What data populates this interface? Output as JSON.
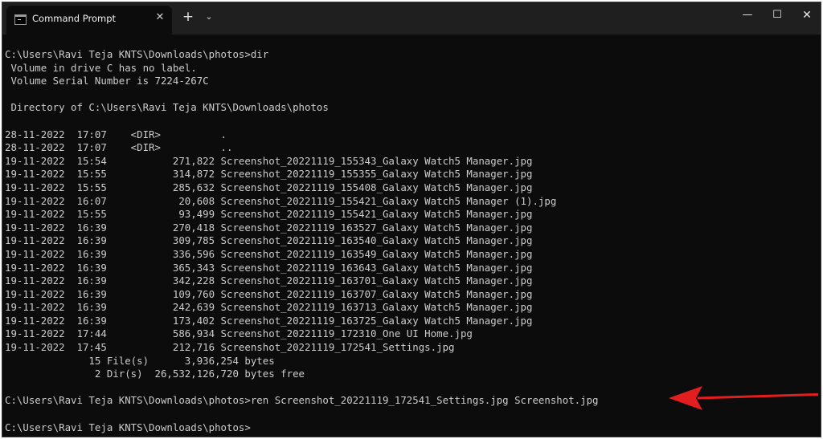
{
  "tab": {
    "title": "Command Prompt",
    "icon": "terminal-icon",
    "close_glyph": "✕",
    "new_tab_glyph": "+",
    "dropdown_glyph": "⌄"
  },
  "window_controls": {
    "minimize_glyph": "—",
    "maximize_glyph": "☐",
    "close_glyph": "✕"
  },
  "terminal": {
    "text_color": "#cccccc",
    "background": "#0c0c0c",
    "lines": [
      "C:\\Users\\Ravi Teja KNTS\\Downloads\\photos>dir",
      " Volume in drive C has no label.",
      " Volume Serial Number is 7224-267C",
      "",
      " Directory of C:\\Users\\Ravi Teja KNTS\\Downloads\\photos",
      "",
      "28-11-2022  17:07    <DIR>          .",
      "28-11-2022  17:07    <DIR>          ..",
      "19-11-2022  15:54           271,822 Screenshot_20221119_155343_Galaxy Watch5 Manager.jpg",
      "19-11-2022  15:55           314,872 Screenshot_20221119_155355_Galaxy Watch5 Manager.jpg",
      "19-11-2022  15:55           285,632 Screenshot_20221119_155408_Galaxy Watch5 Manager.jpg",
      "19-11-2022  16:07            20,608 Screenshot_20221119_155421_Galaxy Watch5 Manager (1).jpg",
      "19-11-2022  15:55            93,499 Screenshot_20221119_155421_Galaxy Watch5 Manager.jpg",
      "19-11-2022  16:39           270,418 Screenshot_20221119_163527_Galaxy Watch5 Manager.jpg",
      "19-11-2022  16:39           309,785 Screenshot_20221119_163540_Galaxy Watch5 Manager.jpg",
      "19-11-2022  16:39           336,596 Screenshot_20221119_163549_Galaxy Watch5 Manager.jpg",
      "19-11-2022  16:39           365,343 Screenshot_20221119_163643_Galaxy Watch5 Manager.jpg",
      "19-11-2022  16:39           342,228 Screenshot_20221119_163701_Galaxy Watch5 Manager.jpg",
      "19-11-2022  16:39           109,760 Screenshot_20221119_163707_Galaxy Watch5 Manager.jpg",
      "19-11-2022  16:39           242,639 Screenshot_20221119_163713_Galaxy Watch5 Manager.jpg",
      "19-11-2022  16:39           173,402 Screenshot_20221119_163725_Galaxy Watch5 Manager.jpg",
      "19-11-2022  17:44           586,934 Screenshot_20221119_172310_One UI Home.jpg",
      "19-11-2022  17:45           212,716 Screenshot_20221119_172541_Settings.jpg",
      "              15 File(s)      3,936,254 bytes",
      "               2 Dir(s)  26,532,126,720 bytes free",
      "",
      "C:\\Users\\Ravi Teja KNTS\\Downloads\\photos>ren Screenshot_20221119_172541_Settings.jpg Screenshot.jpg",
      "",
      "C:\\Users\\Ravi Teja KNTS\\Downloads\\photos>"
    ]
  },
  "annotation": {
    "icon": "red-arrow-icon",
    "color": "#e31e1e"
  }
}
